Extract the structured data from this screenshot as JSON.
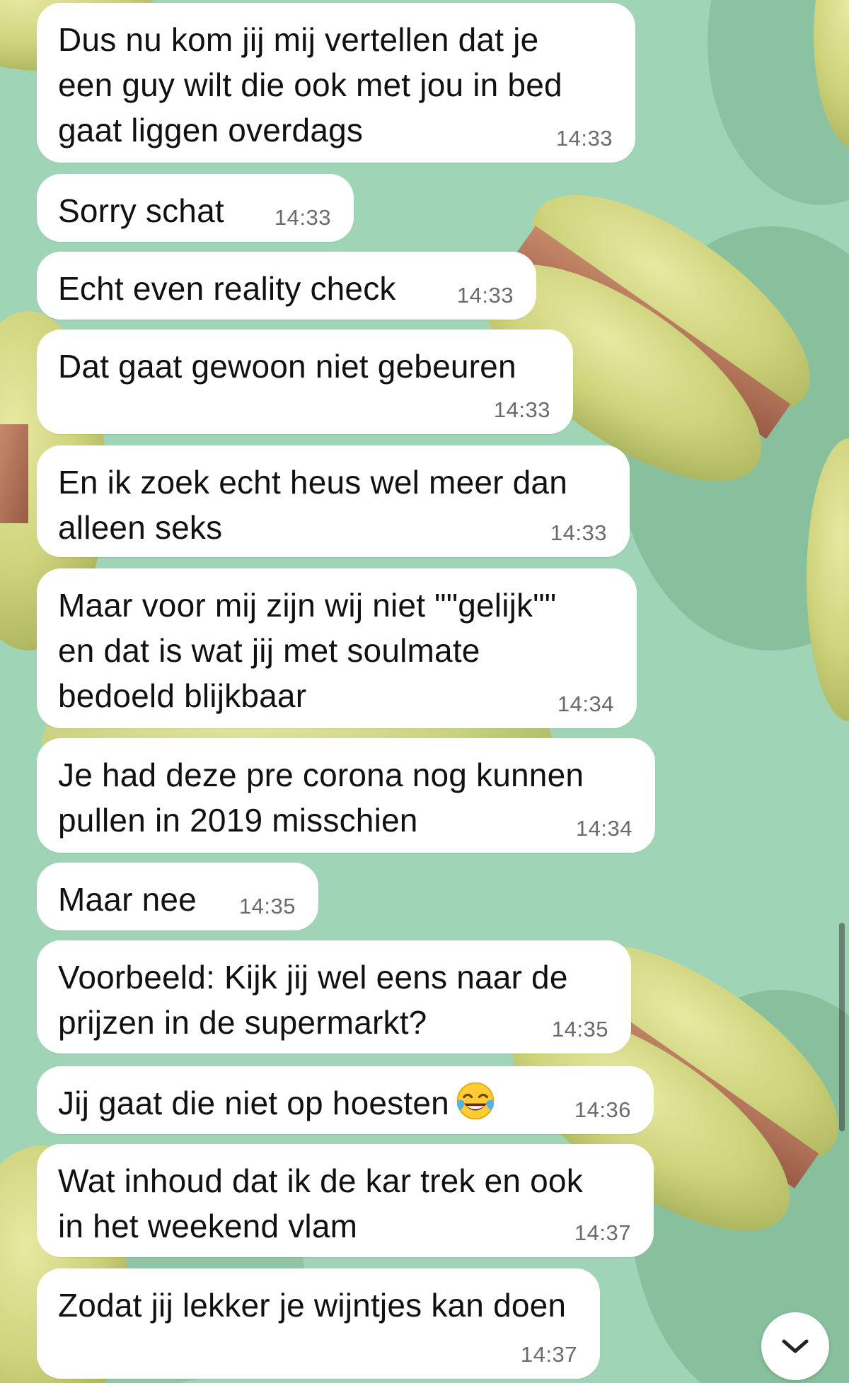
{
  "theme": {
    "wallpaper": "green macaron pattern",
    "background_color": "#9fd4b6",
    "bubble_color": "#ffffff",
    "text_color": "#111111",
    "time_color": "#6b6b6b"
  },
  "messages": [
    {
      "text": "Dus nu kom jij mij vertellen dat je\neen guy wilt die ook met jou in bed\ngaat liggen overdags",
      "time": "14:33"
    },
    {
      "text": "Sorry schat",
      "time": "14:33"
    },
    {
      "text": "Echt even reality check",
      "time": "14:33"
    },
    {
      "text": "Dat gaat gewoon niet gebeuren",
      "time": "14:33"
    },
    {
      "text": "En ik zoek echt heus wel meer dan\nalleen seks",
      "time": "14:33"
    },
    {
      "text": "Maar voor mij zijn wij niet \"\"gelijk\"\"\nen dat is wat jij met soulmate\nbedoeld blijkbaar",
      "time": "14:34"
    },
    {
      "text": "Je had deze pre corona nog kunnen\npullen in 2019 misschien",
      "time": "14:34"
    },
    {
      "text": "Maar nee",
      "time": "14:35"
    },
    {
      "text": "Voorbeeld: Kijk jij wel eens naar de\nprijzen in de supermarkt?",
      "time": "14:35"
    },
    {
      "text": "Jij gaat die niet op hoesten",
      "time": "14:36",
      "emoji": "face-with-tears-of-joy"
    },
    {
      "text": "Wat inhoud dat ik de kar trek en ook\nin het weekend vlam",
      "time": "14:37"
    },
    {
      "text": "Zodat jij lekker je wijntjes kan doen",
      "time": "14:37"
    }
  ],
  "controls": {
    "scroll_down_icon": "chevron-down-icon"
  }
}
